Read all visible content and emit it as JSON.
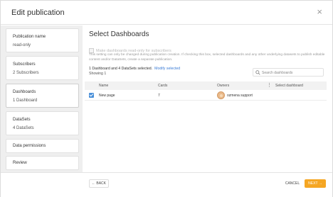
{
  "dialog": {
    "title": "Edit publication",
    "close_symbol": "×"
  },
  "sidebar": {
    "steps": [
      {
        "title": "Publication name",
        "value": "read-only"
      },
      {
        "title": "Subscribers",
        "value": "2 Subscribers"
      },
      {
        "title": "Dashboards",
        "value": "1 Dashboard"
      },
      {
        "title": "DataSets",
        "value": "4 DataSets"
      },
      {
        "title": "Data permissions"
      },
      {
        "title": "Review"
      }
    ]
  },
  "main": {
    "heading": "Select Dashboards",
    "readonly_checkbox_label": "Make dashboards read-only for subscribers",
    "note": "This setting can only be changed during publication creation. If checking this box, selected dashboards and any other underlying datasets to publish editable content and/or DataSets, create a separate publication.",
    "summary": "1 Dashboard and 4 DataSets selected.",
    "modify_link": "Modify selected",
    "showing": "Showing 1",
    "search": {
      "placeholder": "Search dashboards"
    },
    "table": {
      "columns": [
        "Name",
        "Cards",
        "Owners",
        "Select dashboard"
      ],
      "rows": [
        {
          "name": "New page",
          "cards": "7",
          "owner": "ozmena support"
        }
      ]
    }
  },
  "footer": {
    "back_label": "← BACK",
    "cancel_label": "CANCEL",
    "next_label": "NEXT →"
  },
  "colors": {
    "accent": "#f5a623",
    "link": "#3a7bd5",
    "checkbox": "#4a90d9",
    "sidebar_bg": "#efefef"
  }
}
